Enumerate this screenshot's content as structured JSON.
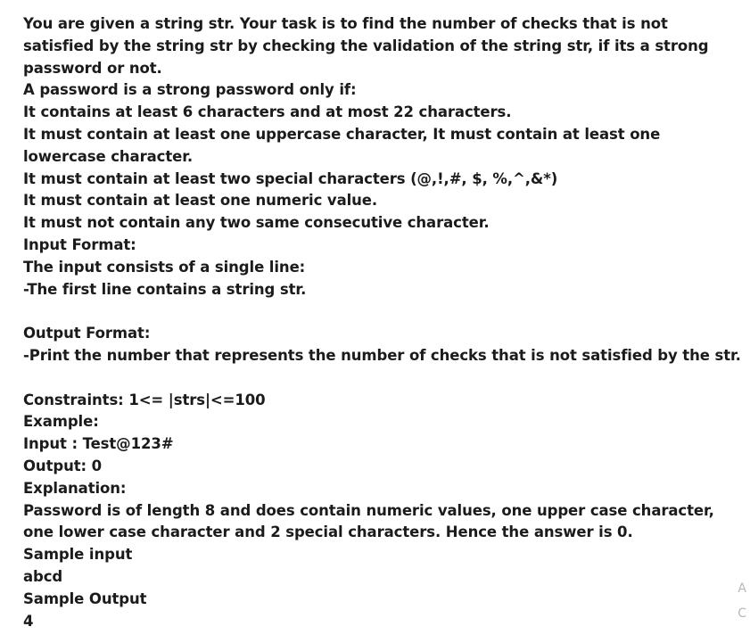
{
  "problem": {
    "intro": "You are given a string str. Your task is to find the number of checks that is not satisfied by the string str by checking the validation of the string str, if its a strong password or not.",
    "rules_heading": "A password is a strong password only if:",
    "rules": [
      "It contains at least 6 characters and at most 22 characters.",
      "It must contain at least one uppercase character, It must contain at least one lowercase character.",
      "It must contain at least two special characters (@,!,#, $, %,^,&*)",
      "It must contain at least one numeric value.",
      "It must not contain any two same consecutive character."
    ]
  },
  "input_format": {
    "heading": "Input Format:",
    "lines": [
      "The input consists of a single line:",
      "-The first line contains a string str."
    ]
  },
  "output_format": {
    "heading": "Output Format:",
    "lines": [
      "-Print the number that represents the number of checks that is not satisfied by the str."
    ]
  },
  "constraints": "Constraints: 1<= |strs|<=100",
  "example": {
    "heading": "Example:",
    "input": "Input : Test@123#",
    "output": "Output: 0",
    "explanation_heading": "Explanation:",
    "explanation": "Password is of length 8 and does contain numeric values, one upper case character, one lower case character and 2 special characters. Hence the answer is 0."
  },
  "sample": {
    "input_heading": "Sample input",
    "input_value": "abcd",
    "output_heading": "Sample Output",
    "output_value": "4"
  },
  "edge_fragments": [
    "A",
    "C"
  ]
}
